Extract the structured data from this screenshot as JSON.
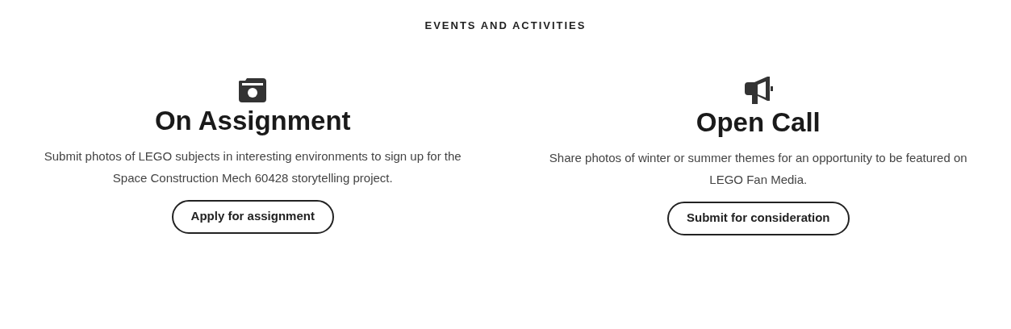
{
  "heading": "EVENTS AND ACTIVITIES",
  "cards": [
    {
      "kind": "camera",
      "title": "On Assignment",
      "description": "Submit photos of LEGO subjects in interesting environments to sign up for the Space Construction Mech 60428 storytelling project.",
      "button": "Apply for assignment"
    },
    {
      "kind": "megaphone",
      "title": "Open Call",
      "description": "Share photos of winter or summer themes for an opportunity to be featured on LEGO Fan Media.",
      "button": "Submit for consideration"
    }
  ]
}
